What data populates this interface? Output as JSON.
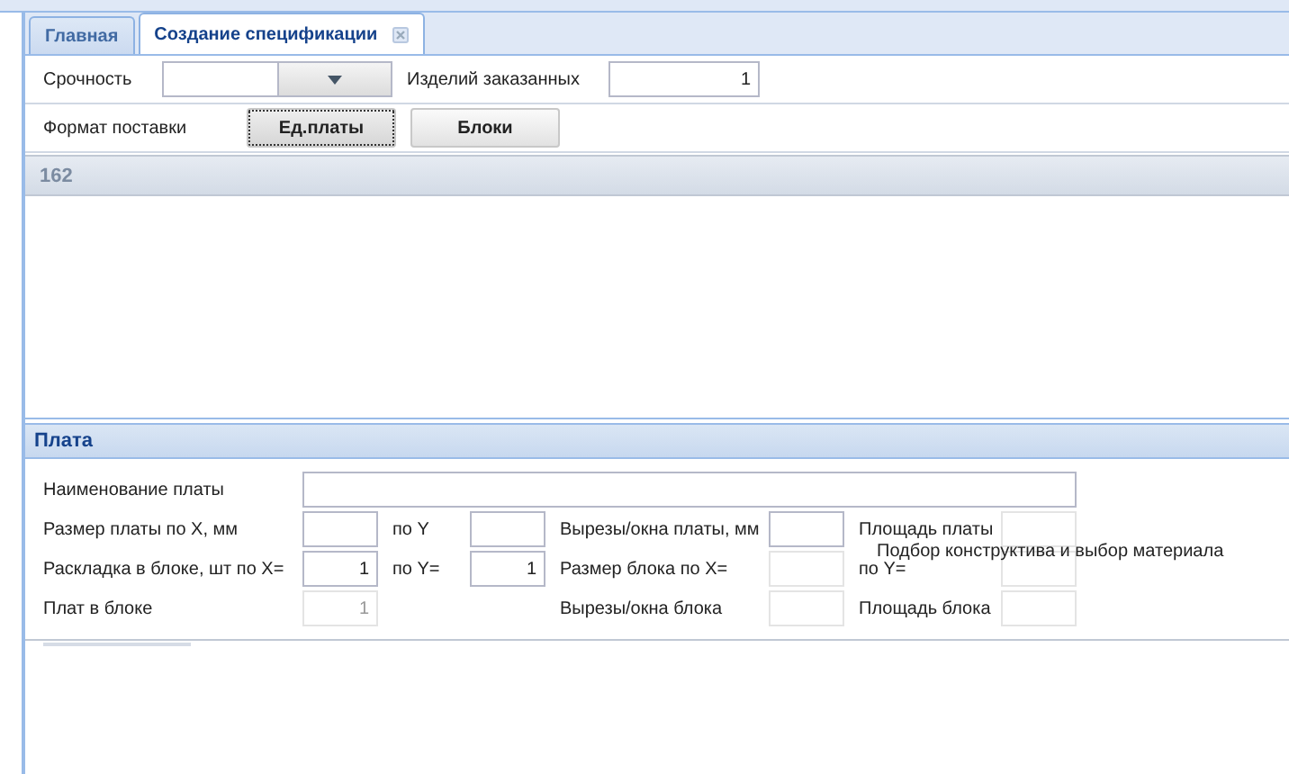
{
  "tabs": [
    {
      "label": "Главная",
      "selected": false,
      "closable": false
    },
    {
      "label": "Создание спецификации",
      "selected": true,
      "closable": true
    }
  ],
  "order": {
    "urgency": {
      "label": "Срочность"
    },
    "quantity": {
      "label": "Изделий заказанных",
      "value": "1"
    }
  },
  "delivery_format": {
    "label": "Формат поставки",
    "options": [
      {
        "label": "Ед.платы",
        "selected": true
      },
      {
        "label": "Блоки",
        "selected": false
      }
    ]
  },
  "grid": {
    "header": "162"
  },
  "board_panel": {
    "title": "Плата",
    "rows": [
      [
        {
          "kind": "label",
          "text": "Наименование платы"
        },
        {
          "kind": "wide_field",
          "disabled": false
        }
      ],
      [
        {
          "kind": "label",
          "text": "Размер платы по X, мм"
        },
        {
          "kind": "field",
          "disabled": false
        },
        {
          "kind": "label",
          "text": "по Y"
        },
        {
          "kind": "field",
          "disabled": false
        },
        {
          "kind": "label",
          "text": "Вырезы/окна платы, мм"
        },
        {
          "kind": "field",
          "disabled": false
        },
        {
          "kind": "label",
          "text": "Площадь платы"
        },
        {
          "kind": "field",
          "disabled": true
        }
      ],
      [
        {
          "kind": "label",
          "text": "Раскладка в блоке, шт по X="
        },
        {
          "kind": "field",
          "value": "1",
          "disabled": false
        },
        {
          "kind": "label",
          "text": "по Y="
        },
        {
          "kind": "field",
          "value": "1",
          "disabled": false
        },
        {
          "kind": "label",
          "text": "Размер блока по X="
        },
        {
          "kind": "field",
          "disabled": true
        },
        {
          "kind": "label",
          "text": "по Y="
        },
        {
          "kind": "field",
          "disabled": true
        }
      ],
      [
        {
          "kind": "label",
          "text": "Плат в блоке"
        },
        {
          "kind": "field",
          "value": "1",
          "disabled": true
        },
        null,
        null,
        {
          "kind": "label",
          "text": "Вырезы/окна блока"
        },
        {
          "kind": "field",
          "disabled": true
        },
        {
          "kind": "label",
          "text": "Площадь блока"
        },
        {
          "kind": "field",
          "disabled": true
        }
      ]
    ],
    "note": "Подбор конструктива и выбор материала"
  }
}
